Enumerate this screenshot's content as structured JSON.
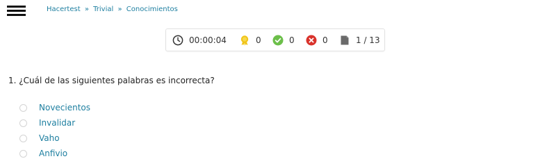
{
  "header": {
    "breadcrumb": [
      "Hacertest",
      "Trivial",
      "Conocimientos"
    ],
    "separator": "»"
  },
  "stats": {
    "timer": "00:00:04",
    "points": "0",
    "correct": "0",
    "incorrect": "0",
    "progress": "1 / 13"
  },
  "colors": {
    "link": "#1e7fa0",
    "points_icon": "#f0c419",
    "correct_icon": "#6cbf4a",
    "incorrect_icon": "#d9322b",
    "progress_icon": "#6a6a6a"
  },
  "icons": {
    "timer": "clock-icon",
    "points": "medal-icon",
    "correct": "check-circle-icon",
    "incorrect": "x-circle-icon",
    "progress": "document-icon"
  },
  "question": {
    "text": "1. ¿Cuál de las siguientes palabras es incorrecta?",
    "options": [
      "Novecientos",
      "Invalidar",
      "Vaho",
      "Anfivio"
    ]
  }
}
